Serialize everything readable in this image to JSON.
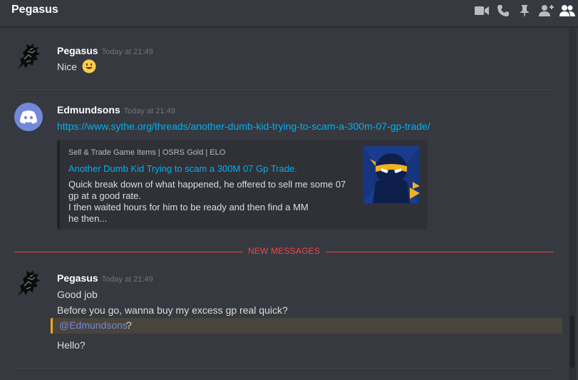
{
  "header": {
    "channel_name": "Pegasus",
    "icons": [
      "video-call-icon",
      "voice-call-icon",
      "pinned-messages-icon",
      "add-friend-to-dm-icon",
      "member-list-icon"
    ]
  },
  "messages": [
    {
      "author": "Pegasus",
      "timestamp": "Today at 21:49",
      "avatar": "pegasus-logo",
      "lines": [
        "Nice"
      ],
      "emoji": "smiley"
    },
    {
      "author": "Edmundsons",
      "timestamp": "Today at 21:49",
      "avatar": "discord-default",
      "link": "https://www.sythe.org/threads/another-dumb-kid-trying-to-scam-a-300m-07-gp-trade/",
      "embed": {
        "provider": "Sell & Trade Game Items | OSRS Gold | ELO",
        "title": "Another Dumb Kid Trying to scam a 300M 07 Gp Trade.",
        "description": [
          "Quick break down of what happened, he offered to sell me some 07",
          "gp at a good rate.",
          "I then waited hours for him to be ready and then find a MM",
          "he then..."
        ],
        "thumbnail": "ninja-mascot"
      }
    }
  ],
  "new_messages_label": "NEW MESSAGES",
  "latest": {
    "author": "Pegasus",
    "timestamp": "Today at 21:49",
    "avatar": "pegasus-logo",
    "line1": "Good job",
    "line2": "Before you go, wanna buy my excess gp real quick?",
    "mention": "@Edmundsons",
    "mention_suffix": "?",
    "line4": "Hello?"
  },
  "colors": {
    "background": "#36393f",
    "link": "#00b0f4",
    "mention": "#7289da",
    "mention_highlight": "#faa61a",
    "new_messages": "#f04747",
    "discord_blurple": "#7289da"
  }
}
